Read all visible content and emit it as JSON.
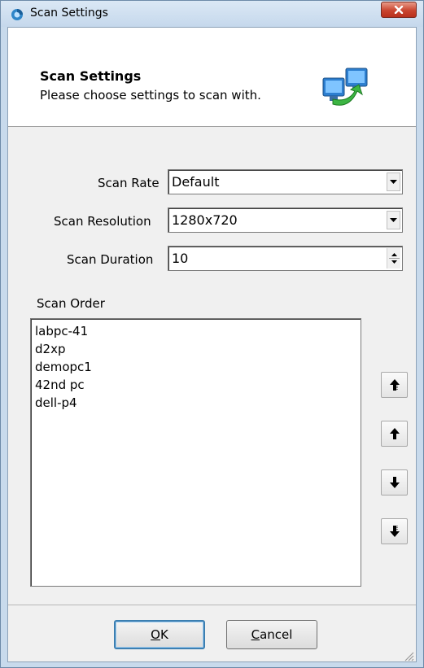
{
  "window": {
    "title": "Scan Settings",
    "close_label": "×"
  },
  "header": {
    "title": "Scan Settings",
    "subtitle": "Please choose settings to scan with."
  },
  "form": {
    "scan_rate": {
      "label": "Scan Rate",
      "value": "Default"
    },
    "scan_resolution": {
      "label": "Scan Resolution",
      "value": "1280x720"
    },
    "scan_duration": {
      "label": "Scan Duration",
      "value": "10"
    }
  },
  "scan_order": {
    "label": "Scan Order",
    "items": [
      "labpc-41",
      "d2xp",
      "demopc1",
      "42nd pc",
      "dell-p4"
    ]
  },
  "buttons": {
    "ok_mnemonic": "O",
    "ok_rest": "K",
    "cancel_mnemonic": "C",
    "cancel_rest": "ancel"
  },
  "colors": {
    "accent": "#3c7fb1",
    "close_red": "#c9452f",
    "dialog_bg": "#f0f0f0"
  },
  "icons": {
    "app": "scan-app-icon",
    "header": "network-computers-icon",
    "move_top": "move-to-top-icon",
    "move_up": "move-up-icon",
    "move_down": "move-down-icon",
    "move_bottom": "move-to-bottom-icon"
  }
}
